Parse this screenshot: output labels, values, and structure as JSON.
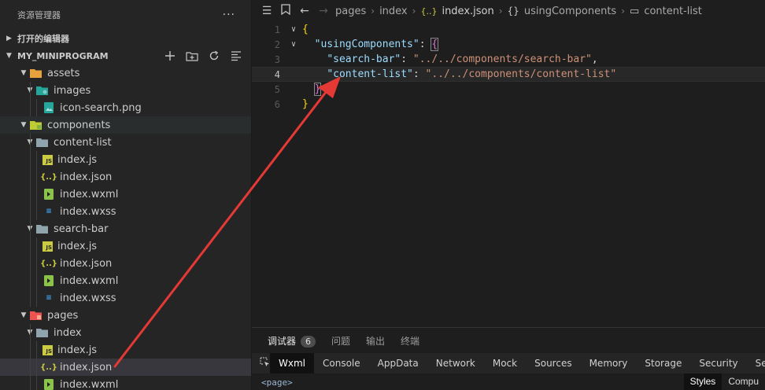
{
  "sidebar": {
    "title": "资源管理器",
    "more": "···",
    "open_editors": "打开的编辑器",
    "project": "MY_MINIPROGRAM",
    "tree": [
      {
        "label": "assets",
        "type": "folder"
      },
      {
        "label": "images",
        "type": "folder"
      },
      {
        "label": "icon-search.png",
        "type": "image"
      },
      {
        "label": "components",
        "type": "folder"
      },
      {
        "label": "content-list",
        "type": "folder"
      },
      {
        "label": "index.js",
        "type": "js"
      },
      {
        "label": "index.json",
        "type": "json"
      },
      {
        "label": "index.wxml",
        "type": "wxml"
      },
      {
        "label": "index.wxss",
        "type": "wxss"
      },
      {
        "label": "search-bar",
        "type": "folder"
      },
      {
        "label": "index.js",
        "type": "js"
      },
      {
        "label": "index.json",
        "type": "json"
      },
      {
        "label": "index.wxml",
        "type": "wxml"
      },
      {
        "label": "index.wxss",
        "type": "wxss"
      },
      {
        "label": "pages",
        "type": "folder"
      },
      {
        "label": "index",
        "type": "folder"
      },
      {
        "label": "index.js",
        "type": "js"
      },
      {
        "label": "index.json",
        "type": "json"
      },
      {
        "label": "index.wxml",
        "type": "wxml"
      }
    ]
  },
  "icons": {
    "js": "JS",
    "json": "{..}",
    "wxss": "≡"
  },
  "breadcrumb": {
    "items": [
      "pages",
      "index",
      "index.json",
      "usingComponents",
      "content-list"
    ],
    "json_icon": "{..}",
    "obj_icon": "{}",
    "field_icon": "▭"
  },
  "code": {
    "line_numbers": [
      "1",
      "2",
      "3",
      "4",
      "5",
      "6"
    ],
    "brace_open": "{",
    "brace_close": "}",
    "key_using": "\"usingComponents\"",
    "key_search": "\"search-bar\"",
    "val_search": "\"../../components/search-bar\"",
    "key_content": "\"content-list\"",
    "val_content": "\"../../components/content-list\"",
    "colon": ": ",
    "comma": ",",
    "indent1": "  ",
    "indent2": "    "
  },
  "panel": {
    "tabs": [
      "调试器",
      "问题",
      "输出",
      "终端"
    ],
    "debugger_badge": "6",
    "dev_tabs": [
      "Wxml",
      "Console",
      "AppData",
      "Network",
      "Mock",
      "Sources",
      "Memory",
      "Storage",
      "Security",
      "Sen"
    ],
    "element_text": "<page>",
    "styles_tab": "Styles",
    "computed_tab": "Compu"
  },
  "colors": {
    "arrow": "#e53935"
  }
}
